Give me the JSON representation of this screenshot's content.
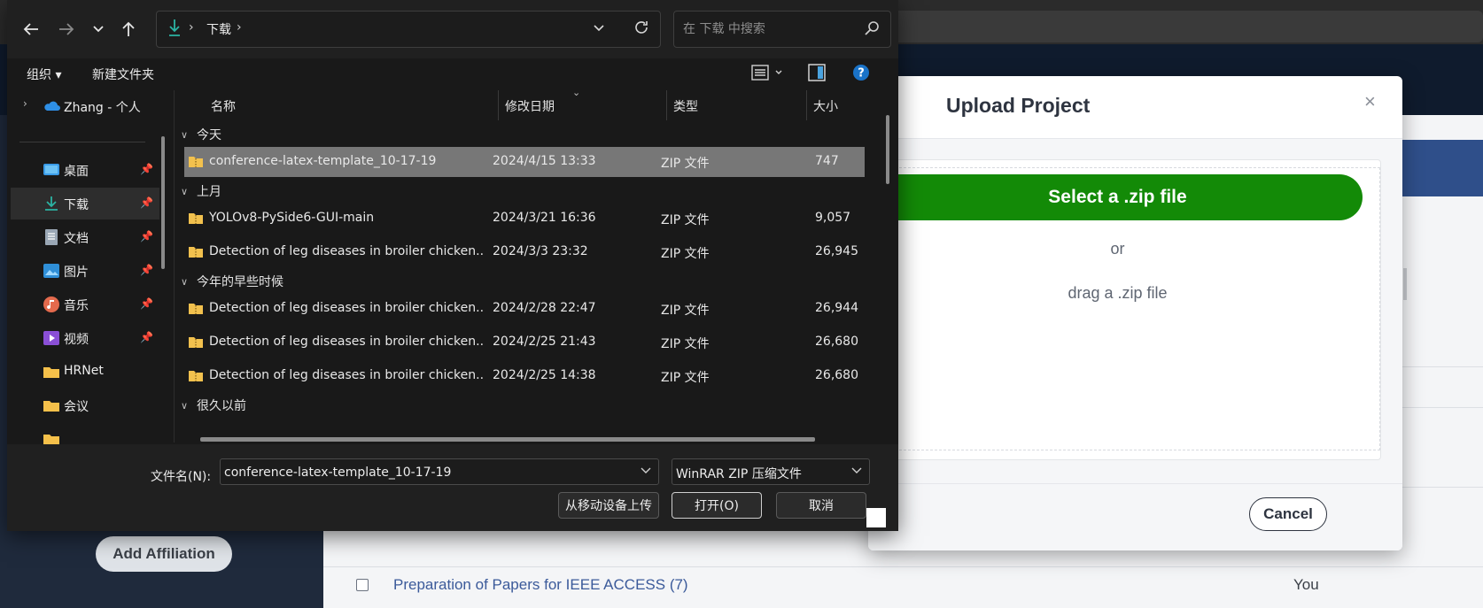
{
  "background": {
    "affiliation_button": "Add Affiliation",
    "project_link": "Preparation of Papers for IEEE ACCESS (7)",
    "owner": "You"
  },
  "upload_modal": {
    "title": "Upload Project",
    "close_glyph": "×",
    "select_button": "Select a .zip file",
    "or_text": "or",
    "drag_text": "drag a .zip file",
    "cancel_button": "Cancel",
    "accent_color": "#138a07"
  },
  "file_dialog": {
    "breadcrumb": {
      "location": "下载",
      "separator": "›"
    },
    "search": {
      "placeholder": "在 下载 中搜索"
    },
    "toolbar": {
      "organize": "组织 ▾",
      "new_folder": "新建文件夹",
      "help": "?"
    },
    "nav": {
      "onedrive": "Zhang - 个人",
      "items": [
        {
          "label": "桌面",
          "icon": "desktop-icon",
          "pinned": true
        },
        {
          "label": "下载",
          "icon": "download-icon",
          "pinned": true,
          "selected": true
        },
        {
          "label": "文档",
          "icon": "documents-icon",
          "pinned": true
        },
        {
          "label": "图片",
          "icon": "pictures-icon",
          "pinned": true
        },
        {
          "label": "音乐",
          "icon": "music-icon",
          "pinned": true
        },
        {
          "label": "视频",
          "icon": "videos-icon",
          "pinned": true
        },
        {
          "label": "HRNet",
          "icon": "folder-icon",
          "pinned": false
        },
        {
          "label": "会议",
          "icon": "folder-icon",
          "pinned": false
        }
      ]
    },
    "columns": {
      "name": "名称",
      "date": "修改日期",
      "type": "类型",
      "size": "大小"
    },
    "groups": {
      "today": "今天",
      "last_month": "上月",
      "earlier_this_year": "今年的早些时候",
      "long_ago": "很久以前"
    },
    "files": [
      {
        "name": "conference-latex-template_10-17-19",
        "date": "2024/4/15 13:33",
        "type": "ZIP 文件",
        "size": "747",
        "selected": true
      },
      {
        "name": "YOLOv8-PySide6-GUI-main",
        "date": "2024/3/21 16:36",
        "type": "ZIP 文件",
        "size": "9,057"
      },
      {
        "name": "Detection of leg diseases in broiler chicken...",
        "date": "2024/3/3 23:32",
        "type": "ZIP 文件",
        "size": "26,945"
      },
      {
        "name": "Detection of leg diseases in broiler chicken...",
        "date": "2024/2/28 22:47",
        "type": "ZIP 文件",
        "size": "26,944"
      },
      {
        "name": "Detection of leg diseases in broiler chicken...",
        "date": "2024/2/25 21:43",
        "type": "ZIP 文件",
        "size": "26,680"
      },
      {
        "name": "Detection of leg diseases in broiler chicken...",
        "date": "2024/2/25 14:38",
        "type": "ZIP 文件",
        "size": "26,680"
      }
    ],
    "filename_label": "文件名(N):",
    "filename_value": "conference-latex-template_10-17-19",
    "file_type_value": "WinRAR ZIP 压缩文件",
    "buttons": {
      "upload_mobile": "从移动设备上传",
      "open": "打开(O)",
      "cancel": "取消"
    }
  }
}
